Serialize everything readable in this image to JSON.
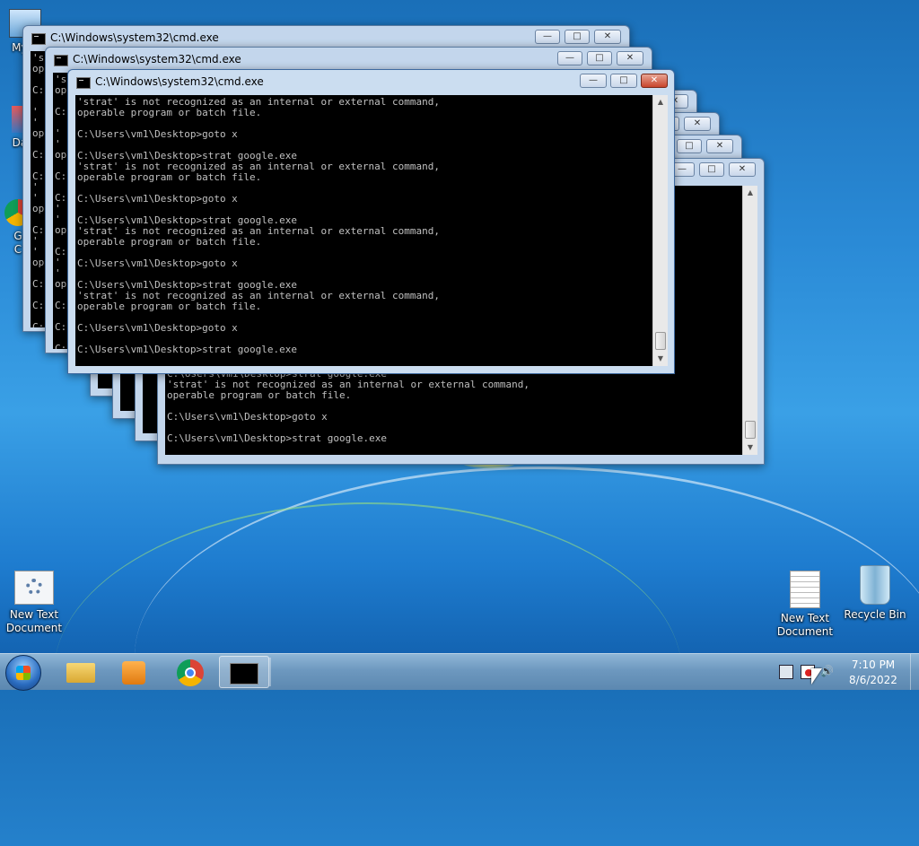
{
  "desktop": {
    "icons": [
      {
        "label": "My C"
      },
      {
        "label": "Data"
      },
      {
        "label": "G\nC"
      },
      {
        "label": "New Text\nDocument"
      },
      {
        "label": "New Text\nDocument"
      },
      {
        "label": "Recycle Bin"
      }
    ]
  },
  "windows": {
    "title": "C:\\Windows\\system32\\cmd.exe",
    "minimize": "—",
    "maximize": "□",
    "close": "✕"
  },
  "consoles": {
    "back1_edge": "'s\nop\n\nC:\n\n'\n'\nop\n\nC:\n\nC:\n'\n'\nop\n\nC:\n'\n'\nop\n\nC:\n\nC:\n\nC:",
    "front": "'strat' is not recognized as an internal or external command,\noperable program or batch file.\n\nC:\\Users\\vm1\\Desktop>goto x\n\nC:\\Users\\vm1\\Desktop>strat google.exe\n'strat' is not recognized as an internal or external command,\noperable program or batch file.\n\nC:\\Users\\vm1\\Desktop>goto x\n\nC:\\Users\\vm1\\Desktop>strat google.exe\n'strat' is not recognized as an internal or external command,\noperable program or batch file.\n\nC:\\Users\\vm1\\Desktop>goto x\n\nC:\\Users\\vm1\\Desktop>strat google.exe\n'strat' is not recognized as an internal or external command,\noperable program or batch file.\n\nC:\\Users\\vm1\\Desktop>goto x\n\nC:\\Users\\vm1\\Desktop>strat google.exe",
    "right": "C:\\Users\\vm1\\Desktop>strat google.exe\n'strat' is not recognized as an internal or external command,\noperable program or batch file.\n\nC:\\Users\\vm1\\Desktop>goto x\n\nC:\\Users\\vm1\\Desktop>strat google.exe"
  },
  "taskbar": {
    "start": "start-orb",
    "pinned": [
      "windows-explorer",
      "media-player",
      "chrome",
      "cmd"
    ],
    "clock_time": "7:10 PM",
    "clock_date": "8/6/2022"
  }
}
